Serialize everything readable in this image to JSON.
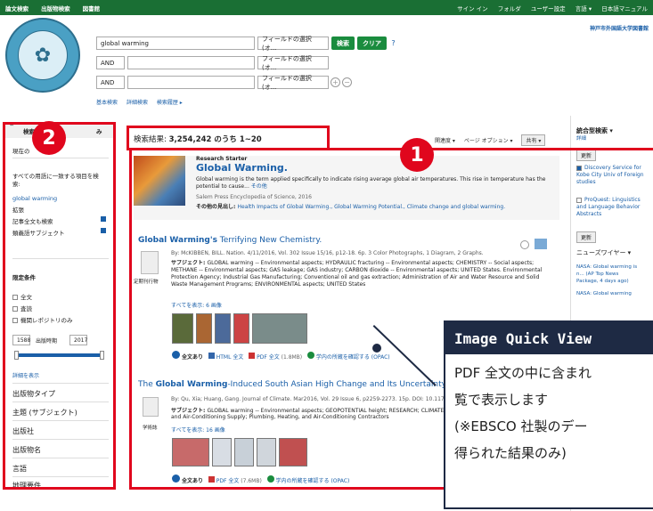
{
  "topbar": {
    "left": [
      "論文検索",
      "出版物検索",
      "図書館"
    ],
    "right": [
      "サイン イン",
      "フォルダ",
      "ユーザー設定",
      "言語 ▾",
      "日本語マニュアル"
    ]
  },
  "search": {
    "query": "global warming",
    "field_select": "フィールドの選択 (オ...",
    "bool_ops": [
      "AND",
      "AND"
    ],
    "search_btn": "検索",
    "clear_btn": "クリア",
    "help": "?",
    "add": "+",
    "remove": "−",
    "links": [
      "基本検索",
      "詳細検索",
      "検索履歴 ▸"
    ]
  },
  "univ_name": "神戸市外国語大学図書館",
  "left": {
    "header": "検索条件",
    "header_right": "み",
    "current": "現在の",
    "all_words_label": "すべての用語に一致する項目を検索:",
    "all_words_value": "global warming",
    "expand_label": "拡張",
    "expand_items": [
      "記事全文も検索",
      "類義語サブジェクト"
    ],
    "limit_label": "限定条件",
    "limit_items": [
      "全文",
      "査読",
      "機関レポジトリのみ"
    ],
    "year_label": "出版時期",
    "year_from": "1588",
    "year_to": "2017",
    "show_more": "詳細を表示",
    "facets": [
      "出版物タイプ",
      "主題 (サブジェクト)",
      "出版社",
      "出版物名",
      "言語",
      "地理要件"
    ]
  },
  "results": {
    "count_label": "検索結果: ",
    "count_value": "3,254,242 のうち 1~20",
    "sort": "関連度 ▾",
    "page_opts": "ページ オプション ▾",
    "share": "共有 ▾",
    "rs_label": "Research Starter",
    "rs_title": "Global Warming.",
    "rs_snippet": "Global warming is the term applied specifically to indicate rising average global air temperatures. This rise in temperature has the potential to cause...",
    "rs_more": "その他",
    "rs_source": "Salem Press Encyclopedia of Science, 2016",
    "rs_related_label": "その他の見出し: ",
    "rs_related": "Health Impacts of Global Warming., Global Warming Potential., Climate change and global warming.",
    "r1_title_bold": "Global Warming's",
    "r1_title": " Terrifying New Chemistry.",
    "r1_by": "By: McKIBBEN, BILL. Nation. 4/11/2016, Vol. 302 Issue 15/16, p12-18. 6p. 3 Color Photographs, 1 Diagram, 2 Graphs.",
    "r1_subj_label": "サブジェクト: ",
    "r1_subj": "GLOBAL warming -- Environmental aspects; HYDRAULIC fracturing -- Environmental aspects; CHEMISTRY -- Social aspects; METHANE -- Environmental aspects; GAS leakage; GAS industry; CARBON dioxide -- Environmental aspects; UNITED States. Environmental Protection Agency; Industrial Gas Manufacturing; Conventional oil and gas extraction; Administration of Air and Water Resource and Solid Waste Management Programs; ENVIRONMENTAL aspects; UNITED States",
    "r1_type": "定期刊行物",
    "r1_images": "すべてを表示: 6 画像",
    "r1_links": [
      "全文あり",
      "HTML 全文",
      "PDF 全文",
      "(1.8MB)",
      "学内の所蔵を確認する (OPAC)"
    ],
    "r2_title_pre": "The ",
    "r2_title_bold": "Global Warming",
    "r2_title": "-Induced South Asian High Change and Its Uncertainty",
    "r2_by": "By: Qu, Xia; Huang, Gang. Journal of Climate. Mar2016, Vol. 29 Issue 6, p2259-2273. 15p. DOI: 10.1175/JCLI-D-15-0512.1",
    "r2_subj_label": "サブジェクト: ",
    "r2_subj": "GLOBAL warming -- Environmental aspects; GEOPOTENTIAL height; RESEARCH; CLIMATE",
    "r2_subj2": "and Air-Conditioning Supply; Plumbing, Heating, and Air-Conditioning Contractors",
    "r2_type": "学術誌",
    "r2_images": "すべてを表示: 16 画像",
    "r2_links": [
      "全文あり",
      "PDF 全文",
      "(7.6MB)",
      "学内の所蔵を確認する (OPAC)"
    ]
  },
  "right": {
    "title": "統合型検索 ▾",
    "detail": "詳細",
    "update": "更新",
    "sources": [
      "Discovery Service for Kobe City Univ of Foreign studies",
      "ProQuest: Linguistics and Language Behavior Abstracts"
    ],
    "update2": "更新",
    "news_title": "ニューズワイヤー ▾",
    "news1": "NASA: Global warming is n... (AP Top News Package, 4 days ago)",
    "news2": "NASA: Global warming"
  },
  "badges": [
    "2",
    "1"
  ],
  "popup": {
    "title": "Image Quick View",
    "lines": [
      "PDF 全文の中に含まれ",
      "覧で表示します",
      "(※EBSCO 社製のデー",
      "得られた結果のみ)"
    ]
  },
  "colors": {
    "topbar": "#1a6f34",
    "highlight": "#e0061d",
    "link": "#1a5fa8",
    "popup": "#1e2a44"
  }
}
